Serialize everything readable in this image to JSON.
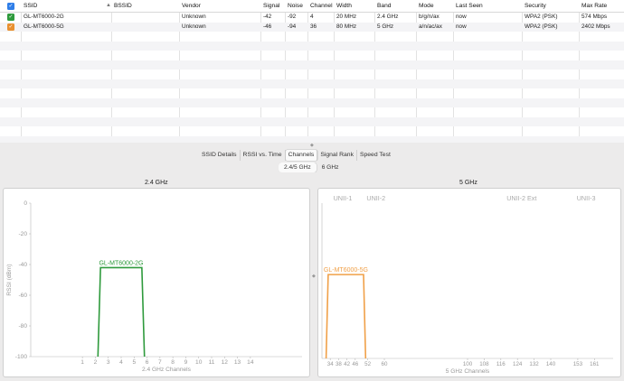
{
  "table": {
    "columns": [
      {
        "key": "ssid",
        "label": "SSID"
      },
      {
        "key": "bssid",
        "label": "BSSID"
      },
      {
        "key": "vendor",
        "label": "Vendor"
      },
      {
        "key": "signal",
        "label": "Signal"
      },
      {
        "key": "noise",
        "label": "Noise"
      },
      {
        "key": "channel",
        "label": "Channel"
      },
      {
        "key": "width",
        "label": "Width"
      },
      {
        "key": "band",
        "label": "Band"
      },
      {
        "key": "mode",
        "label": "Mode"
      },
      {
        "key": "last_seen",
        "label": "Last Seen"
      },
      {
        "key": "security",
        "label": "Security"
      },
      {
        "key": "max_rate",
        "label": "Max Rate"
      }
    ],
    "rows": [
      {
        "checked": true,
        "check_color": "#2e9a3c",
        "ssid": "GL-MT6000-2G",
        "bssid": "",
        "vendor": "Unknown",
        "signal": "-42",
        "noise": "-92",
        "channel": "4",
        "width": "20 MHz",
        "band": "2.4 GHz",
        "mode": "b/g/n/ax",
        "last_seen": "now",
        "security": "WPA2 (PSK)",
        "max_rate": "574 Mbps"
      },
      {
        "checked": true,
        "check_color": "#e9902f",
        "ssid": "GL-MT6000-5G",
        "bssid": "",
        "vendor": "Unknown",
        "signal": "-46",
        "noise": "-94",
        "channel": "36",
        "width": "80 MHz",
        "band": "5 GHz",
        "mode": "a/n/ac/ax",
        "last_seen": "now",
        "security": "WPA2 (PSK)",
        "max_rate": "2402 Mbps"
      }
    ]
  },
  "tabs": [
    {
      "label": "SSID Details",
      "active": false
    },
    {
      "label": "RSSI vs. Time",
      "active": false
    },
    {
      "label": "Channels",
      "active": true
    },
    {
      "label": "Signal Rank",
      "active": false
    },
    {
      "label": "Speed Test",
      "active": false
    }
  ],
  "band_segments": [
    {
      "label": "2.4/5 GHz",
      "active": true
    },
    {
      "label": "6 GHz",
      "active": false
    }
  ],
  "chart_data": [
    {
      "type": "area",
      "title": "2.4 GHz",
      "xlabel": "2.4 GHz Channels",
      "ylabel": "RSSI (dBm)",
      "ylim": [
        -100,
        0
      ],
      "xlim": [
        -3,
        18
      ],
      "yticks": [
        0,
        -20,
        -40,
        -60,
        -80,
        -100
      ],
      "xticks": [
        1,
        2,
        3,
        4,
        5,
        6,
        7,
        8,
        9,
        10,
        11,
        12,
        13,
        14
      ],
      "grid": false,
      "series": [
        {
          "name": "GL-MT6000-2G",
          "color": "#2e9a3c",
          "channel": 4,
          "rssi": -42,
          "x": [
            2.2,
            2.4,
            5.6,
            5.8
          ],
          "y": [
            -100,
            -42,
            -42,
            -100
          ]
        }
      ]
    },
    {
      "type": "area",
      "title": "5 GHz",
      "xlabel": "5 GHz Channels",
      "ylim": [
        -100,
        0
      ],
      "xlim": [
        30,
        170
      ],
      "xticks": [
        34,
        38,
        42,
        46,
        52,
        60,
        100,
        108,
        116,
        124,
        132,
        140,
        153,
        161
      ],
      "region_labels": [
        "UNII-1",
        "UNII-2",
        "UNII-2 Ext",
        "UNII-3"
      ],
      "region_positions": [
        40,
        56,
        126,
        157
      ],
      "grid": false,
      "series": [
        {
          "name": "GL-MT6000-5G",
          "color": "#f0a048",
          "channel": 36,
          "rssi": -46,
          "x": [
            32,
            33,
            50,
            51
          ],
          "y": [
            -100,
            -46,
            -46,
            -100
          ]
        }
      ]
    }
  ]
}
